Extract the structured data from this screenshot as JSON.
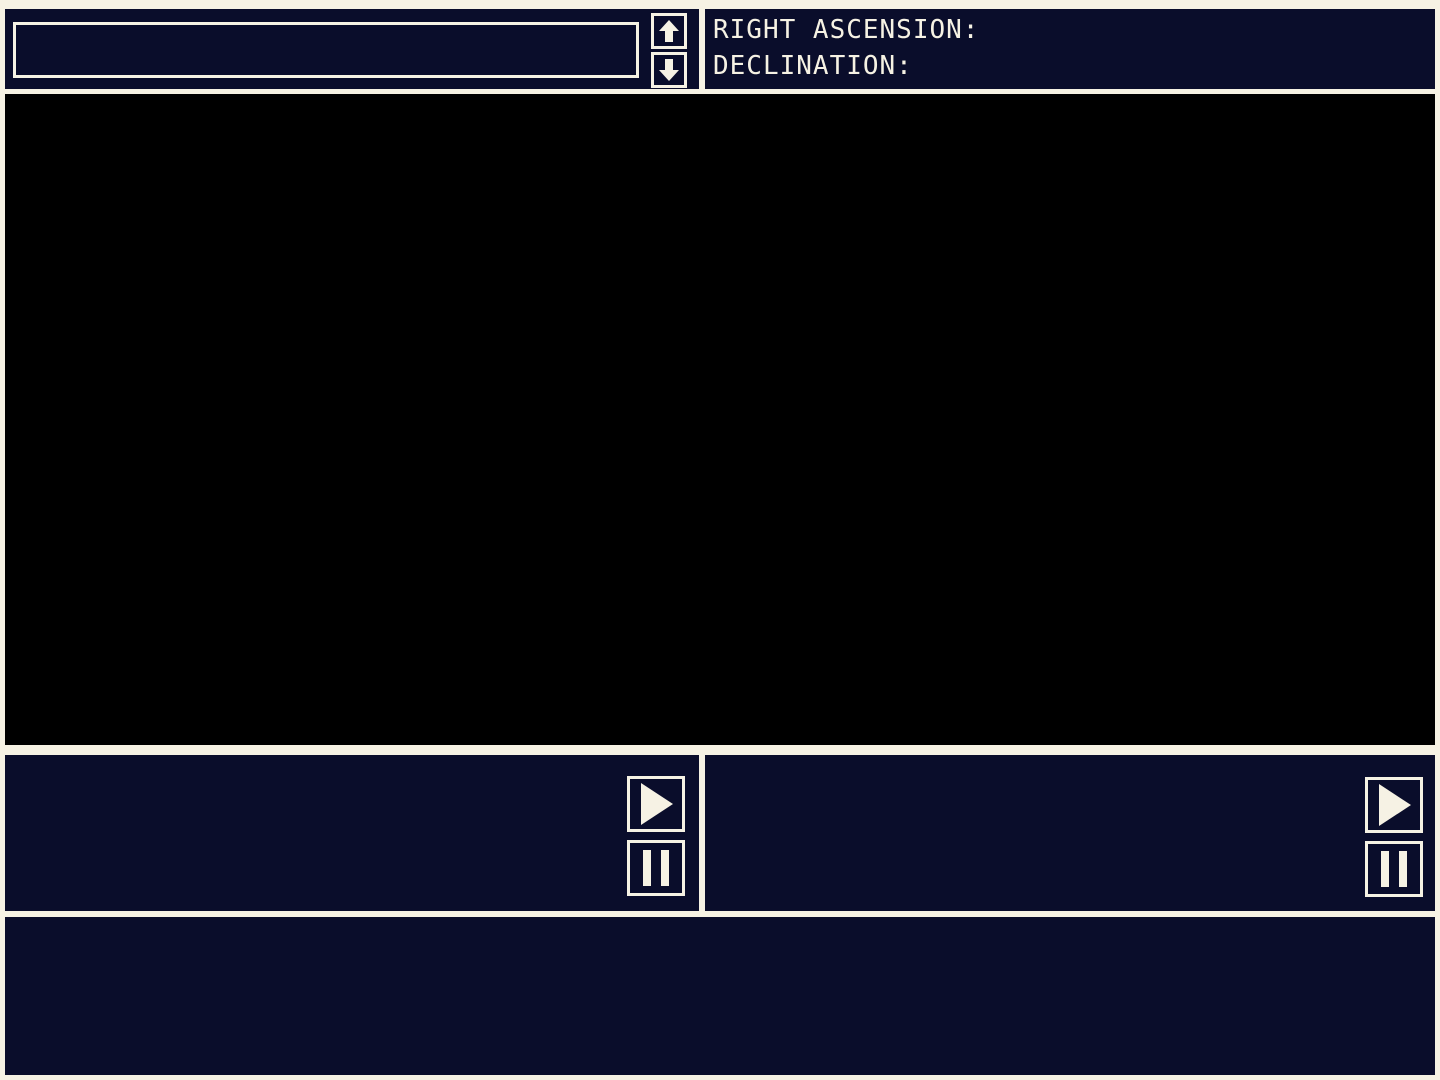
{
  "target_search": {
    "value": "",
    "placeholder": ""
  },
  "coordinates": {
    "right_ascension_label": "RIGHT ASCENSION:",
    "right_ascension_value": "",
    "declination_label": "DECLINATION:",
    "declination_value": ""
  },
  "icons": {
    "scroll_up": "arrow-up-icon",
    "scroll_down": "arrow-down-icon",
    "play": "play-icon",
    "pause": "pause-icon"
  },
  "colors": {
    "panel": "#0a0d2b",
    "viewport": "#000000",
    "foreground": "#f6f2e4"
  }
}
